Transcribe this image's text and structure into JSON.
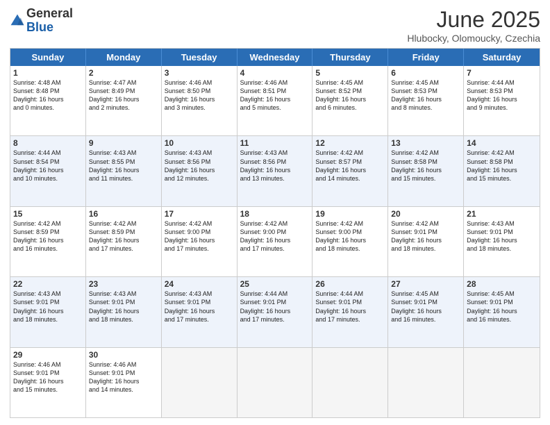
{
  "header": {
    "logo_general": "General",
    "logo_blue": "Blue",
    "month_title": "June 2025",
    "location": "Hlubocky, Olomoucky, Czechia"
  },
  "weekdays": [
    "Sunday",
    "Monday",
    "Tuesday",
    "Wednesday",
    "Thursday",
    "Friday",
    "Saturday"
  ],
  "rows": [
    {
      "alt": false,
      "cells": [
        {
          "day": "1",
          "text": "Sunrise: 4:48 AM\nSunset: 8:48 PM\nDaylight: 16 hours\nand 0 minutes."
        },
        {
          "day": "2",
          "text": "Sunrise: 4:47 AM\nSunset: 8:49 PM\nDaylight: 16 hours\nand 2 minutes."
        },
        {
          "day": "3",
          "text": "Sunrise: 4:46 AM\nSunset: 8:50 PM\nDaylight: 16 hours\nand 3 minutes."
        },
        {
          "day": "4",
          "text": "Sunrise: 4:46 AM\nSunset: 8:51 PM\nDaylight: 16 hours\nand 5 minutes."
        },
        {
          "day": "5",
          "text": "Sunrise: 4:45 AM\nSunset: 8:52 PM\nDaylight: 16 hours\nand 6 minutes."
        },
        {
          "day": "6",
          "text": "Sunrise: 4:45 AM\nSunset: 8:53 PM\nDaylight: 16 hours\nand 8 minutes."
        },
        {
          "day": "7",
          "text": "Sunrise: 4:44 AM\nSunset: 8:53 PM\nDaylight: 16 hours\nand 9 minutes."
        }
      ]
    },
    {
      "alt": true,
      "cells": [
        {
          "day": "8",
          "text": "Sunrise: 4:44 AM\nSunset: 8:54 PM\nDaylight: 16 hours\nand 10 minutes."
        },
        {
          "day": "9",
          "text": "Sunrise: 4:43 AM\nSunset: 8:55 PM\nDaylight: 16 hours\nand 11 minutes."
        },
        {
          "day": "10",
          "text": "Sunrise: 4:43 AM\nSunset: 8:56 PM\nDaylight: 16 hours\nand 12 minutes."
        },
        {
          "day": "11",
          "text": "Sunrise: 4:43 AM\nSunset: 8:56 PM\nDaylight: 16 hours\nand 13 minutes."
        },
        {
          "day": "12",
          "text": "Sunrise: 4:42 AM\nSunset: 8:57 PM\nDaylight: 16 hours\nand 14 minutes."
        },
        {
          "day": "13",
          "text": "Sunrise: 4:42 AM\nSunset: 8:58 PM\nDaylight: 16 hours\nand 15 minutes."
        },
        {
          "day": "14",
          "text": "Sunrise: 4:42 AM\nSunset: 8:58 PM\nDaylight: 16 hours\nand 15 minutes."
        }
      ]
    },
    {
      "alt": false,
      "cells": [
        {
          "day": "15",
          "text": "Sunrise: 4:42 AM\nSunset: 8:59 PM\nDaylight: 16 hours\nand 16 minutes."
        },
        {
          "day": "16",
          "text": "Sunrise: 4:42 AM\nSunset: 8:59 PM\nDaylight: 16 hours\nand 17 minutes."
        },
        {
          "day": "17",
          "text": "Sunrise: 4:42 AM\nSunset: 9:00 PM\nDaylight: 16 hours\nand 17 minutes."
        },
        {
          "day": "18",
          "text": "Sunrise: 4:42 AM\nSunset: 9:00 PM\nDaylight: 16 hours\nand 17 minutes."
        },
        {
          "day": "19",
          "text": "Sunrise: 4:42 AM\nSunset: 9:00 PM\nDaylight: 16 hours\nand 18 minutes."
        },
        {
          "day": "20",
          "text": "Sunrise: 4:42 AM\nSunset: 9:01 PM\nDaylight: 16 hours\nand 18 minutes."
        },
        {
          "day": "21",
          "text": "Sunrise: 4:43 AM\nSunset: 9:01 PM\nDaylight: 16 hours\nand 18 minutes."
        }
      ]
    },
    {
      "alt": true,
      "cells": [
        {
          "day": "22",
          "text": "Sunrise: 4:43 AM\nSunset: 9:01 PM\nDaylight: 16 hours\nand 18 minutes."
        },
        {
          "day": "23",
          "text": "Sunrise: 4:43 AM\nSunset: 9:01 PM\nDaylight: 16 hours\nand 18 minutes."
        },
        {
          "day": "24",
          "text": "Sunrise: 4:43 AM\nSunset: 9:01 PM\nDaylight: 16 hours\nand 17 minutes."
        },
        {
          "day": "25",
          "text": "Sunrise: 4:44 AM\nSunset: 9:01 PM\nDaylight: 16 hours\nand 17 minutes."
        },
        {
          "day": "26",
          "text": "Sunrise: 4:44 AM\nSunset: 9:01 PM\nDaylight: 16 hours\nand 17 minutes."
        },
        {
          "day": "27",
          "text": "Sunrise: 4:45 AM\nSunset: 9:01 PM\nDaylight: 16 hours\nand 16 minutes."
        },
        {
          "day": "28",
          "text": "Sunrise: 4:45 AM\nSunset: 9:01 PM\nDaylight: 16 hours\nand 16 minutes."
        }
      ]
    },
    {
      "alt": false,
      "cells": [
        {
          "day": "29",
          "text": "Sunrise: 4:46 AM\nSunset: 9:01 PM\nDaylight: 16 hours\nand 15 minutes."
        },
        {
          "day": "30",
          "text": "Sunrise: 4:46 AM\nSunset: 9:01 PM\nDaylight: 16 hours\nand 14 minutes."
        },
        {
          "day": "",
          "text": ""
        },
        {
          "day": "",
          "text": ""
        },
        {
          "day": "",
          "text": ""
        },
        {
          "day": "",
          "text": ""
        },
        {
          "day": "",
          "text": ""
        }
      ]
    }
  ]
}
